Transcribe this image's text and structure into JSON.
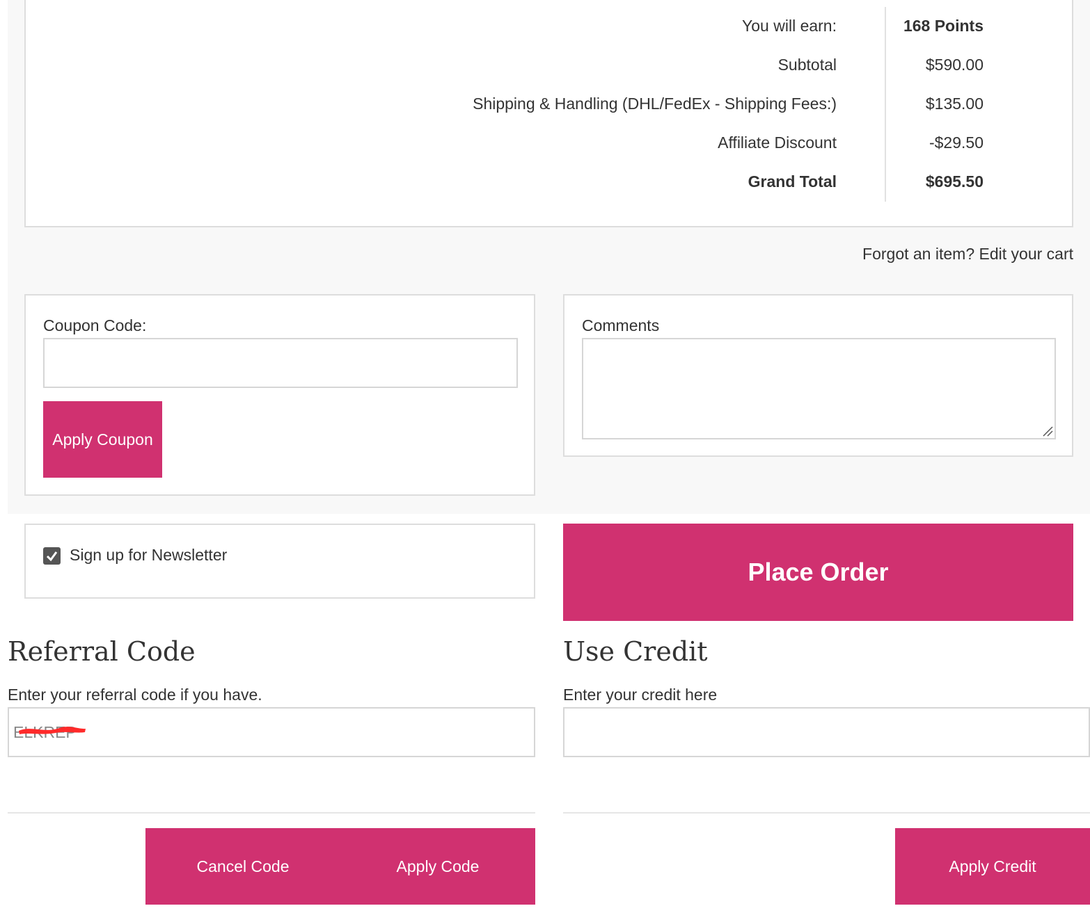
{
  "order_totals": {
    "rows": [
      {
        "label": "You will earn:",
        "value": "168 Points"
      },
      {
        "label": "Subtotal",
        "value": "$590.00"
      },
      {
        "label": "Shipping & Handling (DHL/FedEx - Shipping Fees:)",
        "value": "$135.00"
      },
      {
        "label": "Affiliate Discount",
        "value": "-$29.50"
      },
      {
        "label": "Grand Total",
        "value": "$695.50"
      }
    ]
  },
  "edit_cart_link": "Forgot an item? Edit your cart",
  "coupon": {
    "label": "Coupon Code:",
    "value": "",
    "apply_label": "Apply Coupon"
  },
  "comments": {
    "label": "Comments",
    "value": ""
  },
  "newsletter": {
    "label": "Sign up for Newsletter",
    "checked": true
  },
  "place_order_label": "Place Order",
  "referral": {
    "heading": "Referral Code",
    "hint": "Enter your referral code if you have.",
    "value": "ELKREP",
    "cancel_label": "Cancel Code",
    "apply_label": "Apply Code"
  },
  "credit": {
    "heading": "Use Credit",
    "hint": "Enter your credit here",
    "value": "",
    "apply_label": "Apply Credit"
  },
  "colors": {
    "accent": "#d03170",
    "panel_border": "#dddddd",
    "background_gray": "#f8f8f8",
    "redaction": "#ff2a2a"
  },
  "icons": {
    "checkbox": "check-icon",
    "textarea_grip": "resize-grip-icon"
  }
}
